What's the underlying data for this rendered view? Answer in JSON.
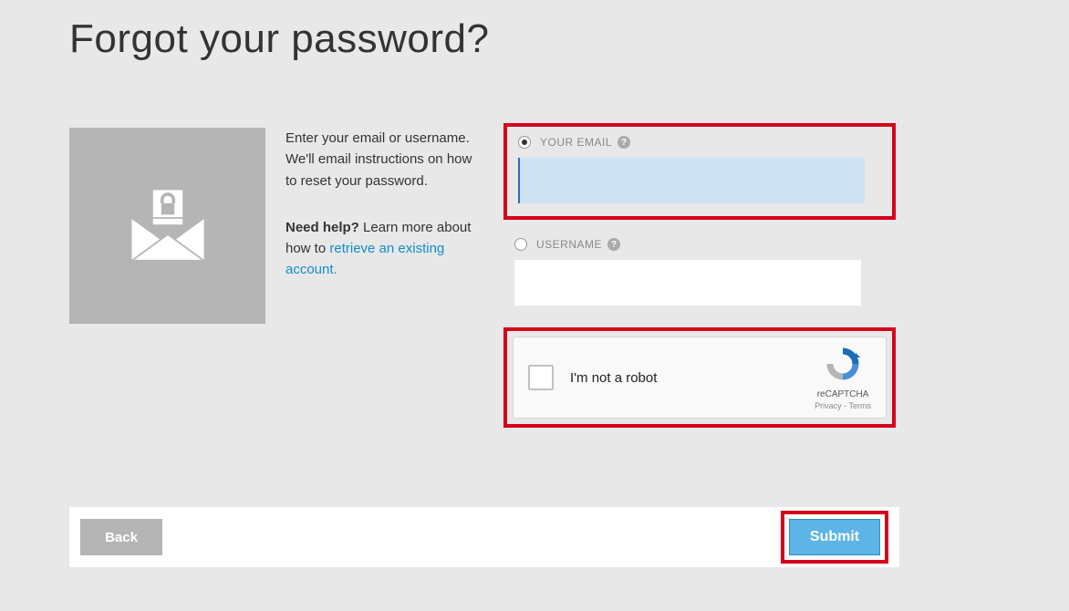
{
  "page": {
    "title": "Forgot your password?"
  },
  "help": {
    "intro": "Enter your email or username. We'll email instructions on how to reset your password.",
    "need_help_label": "Need help?",
    "learn_more_text": " Learn more about how to ",
    "link_text": "retrieve an existing account."
  },
  "form": {
    "email": {
      "label": "YOUR EMAIL",
      "value": "",
      "selected": true
    },
    "username": {
      "label": "USERNAME",
      "value": "",
      "selected": false
    }
  },
  "recaptcha": {
    "text": "I'm not a robot",
    "brand": "reCAPTCHA",
    "privacy": "Privacy",
    "terms": "Terms"
  },
  "buttons": {
    "back": "Back",
    "submit": "Submit"
  }
}
